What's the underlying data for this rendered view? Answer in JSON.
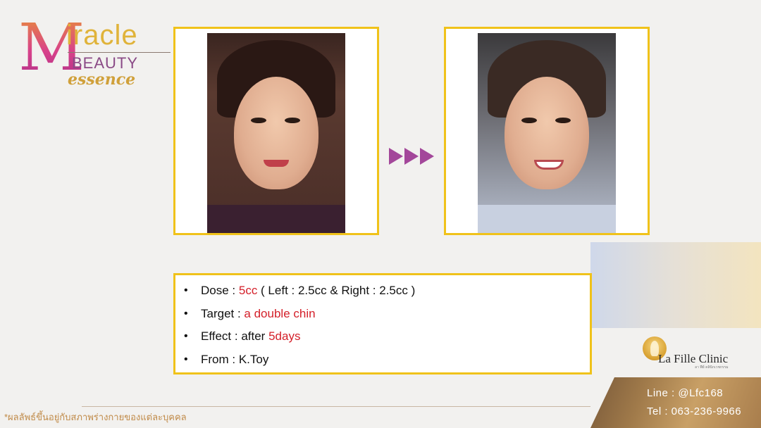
{
  "logo": {
    "letter_m": "M",
    "word_miracle": "iracle",
    "word_beauty": "BEAUTY",
    "word_essence": "essence"
  },
  "photos": {
    "before": "before-photo",
    "after": "after-photo"
  },
  "info": {
    "dose_label": "Dose : ",
    "dose_value": "5cc",
    "dose_detail": " ( Left : 2.5cc & Right : 2.5cc )",
    "target_label": "Target : ",
    "target_value": "a double chin",
    "effect_label": "Effect : after ",
    "effect_value": "5days",
    "from_label": "From : K.Toy"
  },
  "brand": {
    "name": "La Fille Clinic",
    "sub": "ลา ฟีย์ คลินิกเวชกรรม"
  },
  "contact": {
    "line": "Line  :  @Lfc168",
    "tel": "Tel  :  063-236-9966"
  },
  "footer": {
    "note": "*ผลลัพธ์ขึ้นอยู่กับสภาพร่างกายของแต่ละบุคคล"
  },
  "colors": {
    "frame": "#f0c21a",
    "highlight": "#d4202a",
    "arrow": "#a3479a",
    "gold": "#c9a066"
  }
}
